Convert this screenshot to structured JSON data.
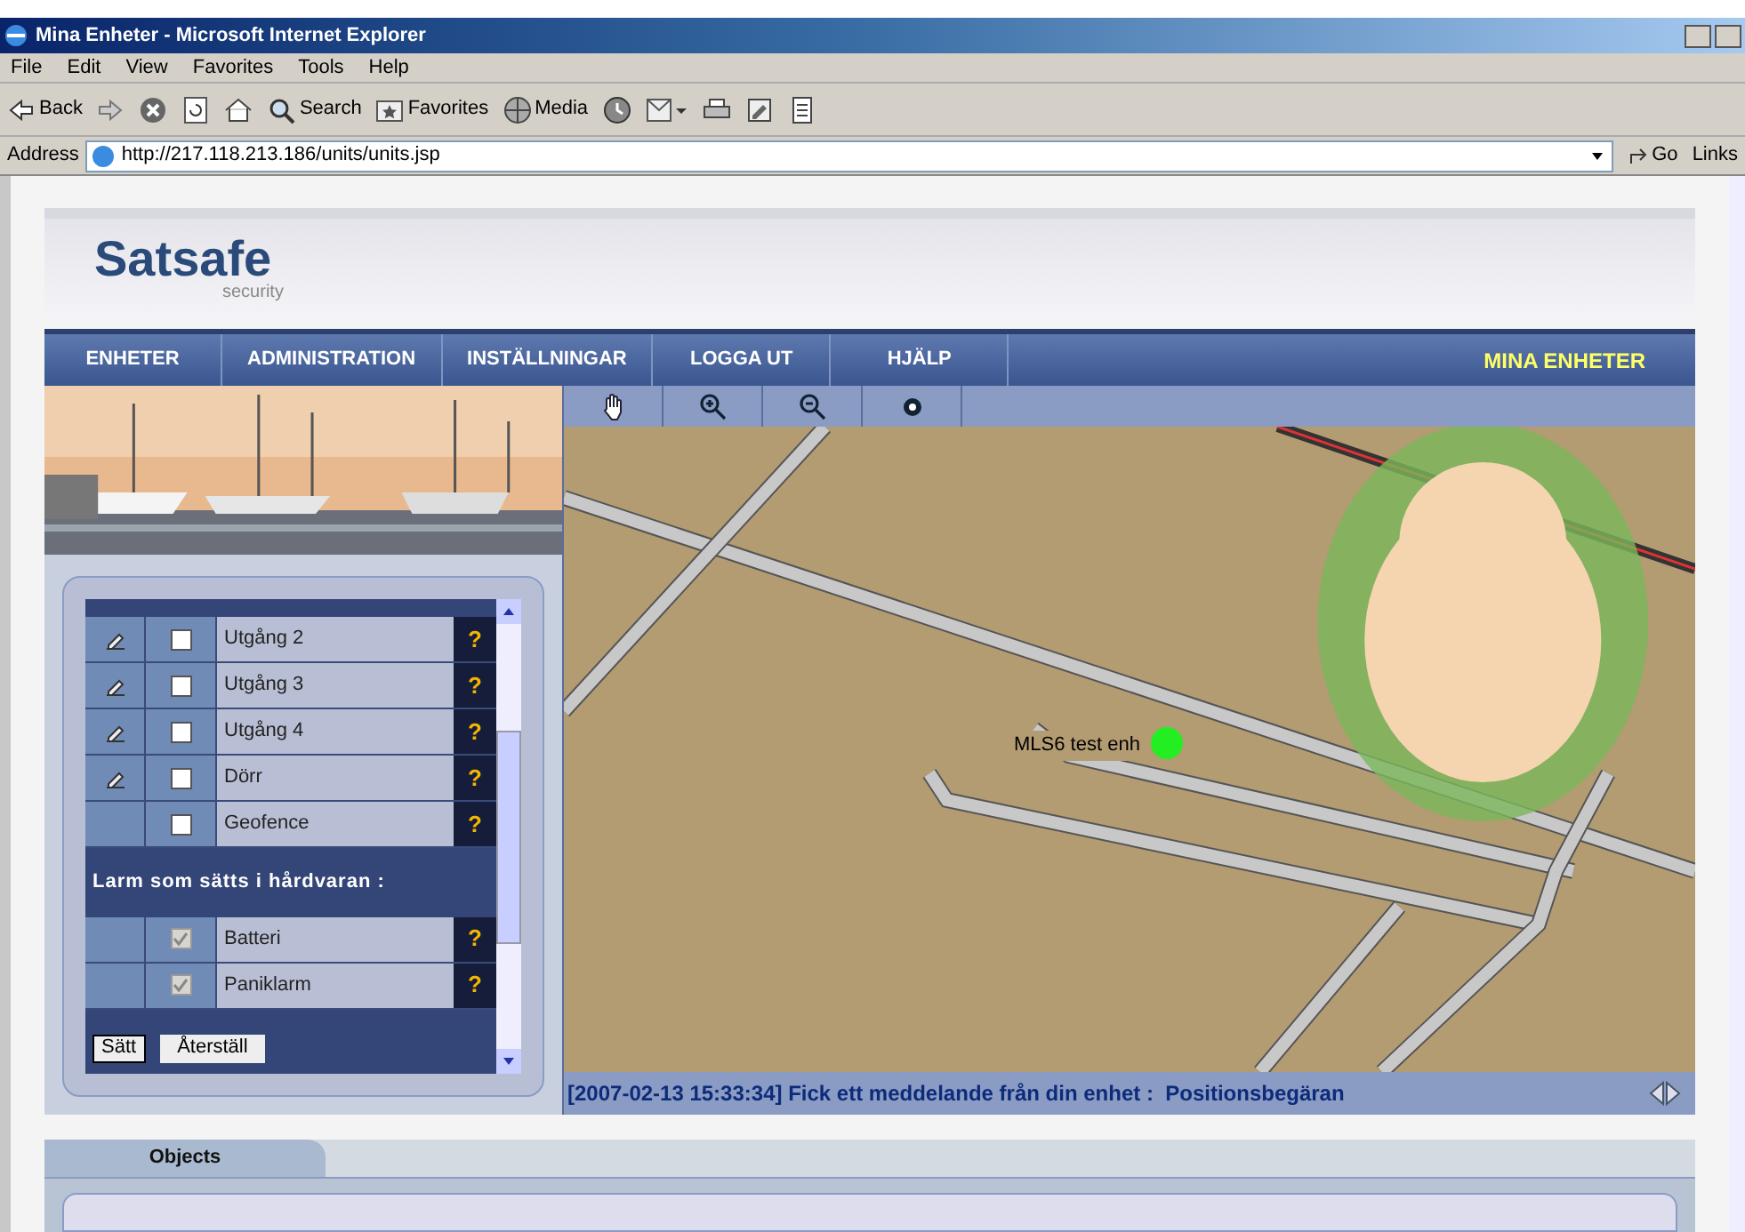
{
  "window": {
    "title": "Mina Enheter - Microsoft Internet Explorer"
  },
  "menu": [
    "File",
    "Edit",
    "View",
    "Favorites",
    "Tools",
    "Help"
  ],
  "toolbar": [
    {
      "kind": "back",
      "label": "Back"
    },
    {
      "kind": "forward"
    },
    {
      "kind": "stop"
    },
    {
      "kind": "refresh"
    },
    {
      "kind": "home"
    },
    {
      "kind": "search",
      "label": "Search"
    },
    {
      "kind": "favorites",
      "label": "Favorites"
    },
    {
      "kind": "media",
      "label": "Media"
    },
    {
      "kind": "history"
    },
    {
      "kind": "mail"
    },
    {
      "kind": "print"
    },
    {
      "kind": "edit"
    },
    {
      "kind": "discuss"
    }
  ],
  "address": {
    "label": "Address",
    "value": "http://217.118.213.186/units/units.jsp",
    "go": "Go",
    "links": "Links"
  },
  "logo": {
    "name": "Satsafe",
    "tagline": "security"
  },
  "nav": [
    {
      "label": "ENHETER",
      "selected": false
    },
    {
      "label": "ADMINISTRATION",
      "selected": false
    },
    {
      "label": "INSTÄLLNINGAR",
      "selected": false
    },
    {
      "label": "LOGGA UT",
      "selected": false
    },
    {
      "label": "HJÄLP",
      "selected": false
    }
  ],
  "page_title": "MINA ENHETER",
  "outputs": [
    {
      "label": "Utgång 2",
      "editable": true,
      "checked": false,
      "disabled": false,
      "help": "?"
    },
    {
      "label": "Utgång 3",
      "editable": true,
      "checked": false,
      "disabled": false,
      "help": "?"
    },
    {
      "label": "Utgång 4",
      "editable": true,
      "checked": false,
      "disabled": false,
      "help": "?"
    },
    {
      "label": "Dörr",
      "editable": true,
      "checked": false,
      "disabled": false,
      "help": "?"
    },
    {
      "label": "Geofence",
      "editable": false,
      "checked": false,
      "disabled": false,
      "help": "?"
    }
  ],
  "alarm_heading": "Larm som sätts i hårdvaran :",
  "alarms": [
    {
      "label": "Batteri",
      "editable": false,
      "checked": true,
      "disabled": true,
      "help": "?"
    },
    {
      "label": "Paniklarm",
      "editable": false,
      "checked": true,
      "disabled": true,
      "help": "?"
    }
  ],
  "buttons": [
    "Sätt",
    "Återställ"
  ],
  "map_tools": [
    {
      "kind": "pan"
    },
    {
      "kind": "zoom-in"
    },
    {
      "kind": "zoom-out"
    },
    {
      "kind": "center"
    }
  ],
  "map": {
    "kind": "picture",
    "marker_label": "MLS6 test enh"
  },
  "status": "[2007-02-13 15:33:34] Fick ett meddelande från din enhet :  Positionsbegäran",
  "tabs": [
    {
      "label": "Objects",
      "selected": true
    }
  ]
}
